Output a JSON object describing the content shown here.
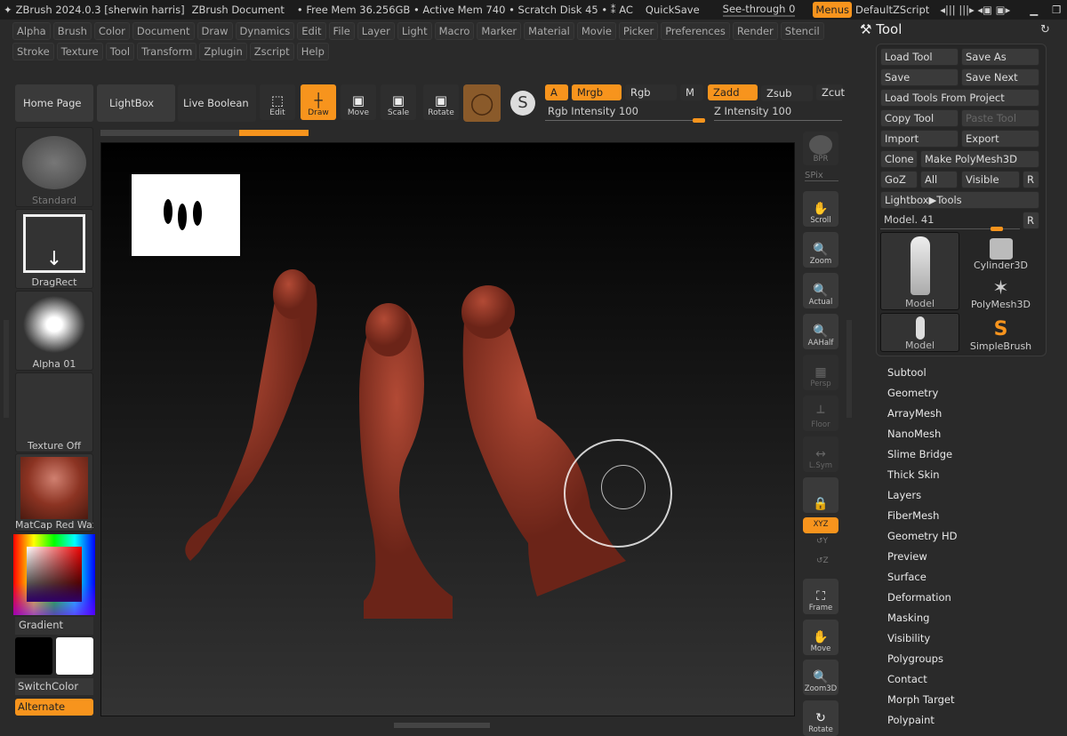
{
  "titlebar": {
    "app": "ZBrush 2024.0.3 [sherwin harris]",
    "document": "ZBrush Document",
    "mem": "• Free Mem 36.256GB • Active Mem 740 • Scratch Disk 45 • ⁑ AC",
    "quicksave": "QuickSave",
    "seethrough": "See-through  0",
    "menus": "Menus",
    "zscript": "DefaultZScript"
  },
  "menus_row1": [
    "Alpha",
    "Brush",
    "Color",
    "Document",
    "Draw",
    "Dynamics",
    "Edit",
    "File",
    "Layer",
    "Light",
    "Macro",
    "Marker",
    "Material",
    "Movie",
    "Picker",
    "Preferences",
    "Render",
    "Stencil"
  ],
  "menus_row2": [
    "Stroke",
    "Texture",
    "Tool",
    "Transform",
    "Zplugin",
    "Zscript",
    "Help"
  ],
  "toolbar": {
    "home": "Home Page",
    "lightbox": "LightBox",
    "live_boolean": "Live Boolean",
    "edit": "Edit",
    "draw": "Draw",
    "move": "Move",
    "scale": "Scale",
    "rotate": "Rotate",
    "a": "A",
    "mrgb": "Mrgb",
    "rgb": "Rgb",
    "m": "M",
    "zadd": "Zadd",
    "zsub": "Zsub",
    "zcut": "Zcut",
    "rgb_intensity": "Rgb Intensity 100",
    "z_intensity": "Z Intensity 100"
  },
  "left": {
    "brush": "Standard",
    "stroke": "DragRect",
    "alpha": "Alpha 01",
    "texture": "Texture Off",
    "material": "MatCap Red Wax",
    "gradient": "Gradient",
    "switch": "SwitchColor",
    "alternate": "Alternate",
    "colors": {
      "main": "#000000",
      "secondary": "#ffffff"
    }
  },
  "right_shelf": {
    "bpr": "BPR",
    "spix": "SPix",
    "buttons": [
      "Scroll",
      "Zoom",
      "Actual",
      "AAHalf",
      "Persp",
      "Floor",
      "L.Sym",
      "",
      "XYZ",
      "Y",
      "Z",
      "Frame",
      "Move",
      "Zoom3D",
      "Rotate"
    ]
  },
  "tool": {
    "title": "Tool",
    "load": "Load Tool",
    "save_as": "Save As",
    "save": "Save",
    "save_next": "Save Next",
    "load_project": "Load Tools From Project",
    "copy": "Copy Tool",
    "paste": "Paste Tool",
    "import": "Import",
    "export": "Export",
    "clone": "Clone",
    "make_poly": "Make PolyMesh3D",
    "goz": "GoZ",
    "all": "All",
    "visible": "Visible",
    "r": "R",
    "lightbox_tools": "Lightbox▶Tools",
    "model_slider": "Model. 41",
    "thumbs": [
      "Model",
      "Cylinder3D",
      "PolyMesh3D",
      "Model",
      "SimpleBrush"
    ],
    "subpalettes": [
      "Subtool",
      "Geometry",
      "ArrayMesh",
      "NanoMesh",
      "Slime Bridge",
      "Thick Skin",
      "Layers",
      "FiberMesh",
      "Geometry HD",
      "Preview",
      "Surface",
      "Deformation",
      "Masking",
      "Visibility",
      "Polygroups",
      "Contact",
      "Morph Target",
      "Polypaint"
    ]
  },
  "colors": {
    "accent": "#f7941d",
    "mesh": "#8b3322"
  }
}
